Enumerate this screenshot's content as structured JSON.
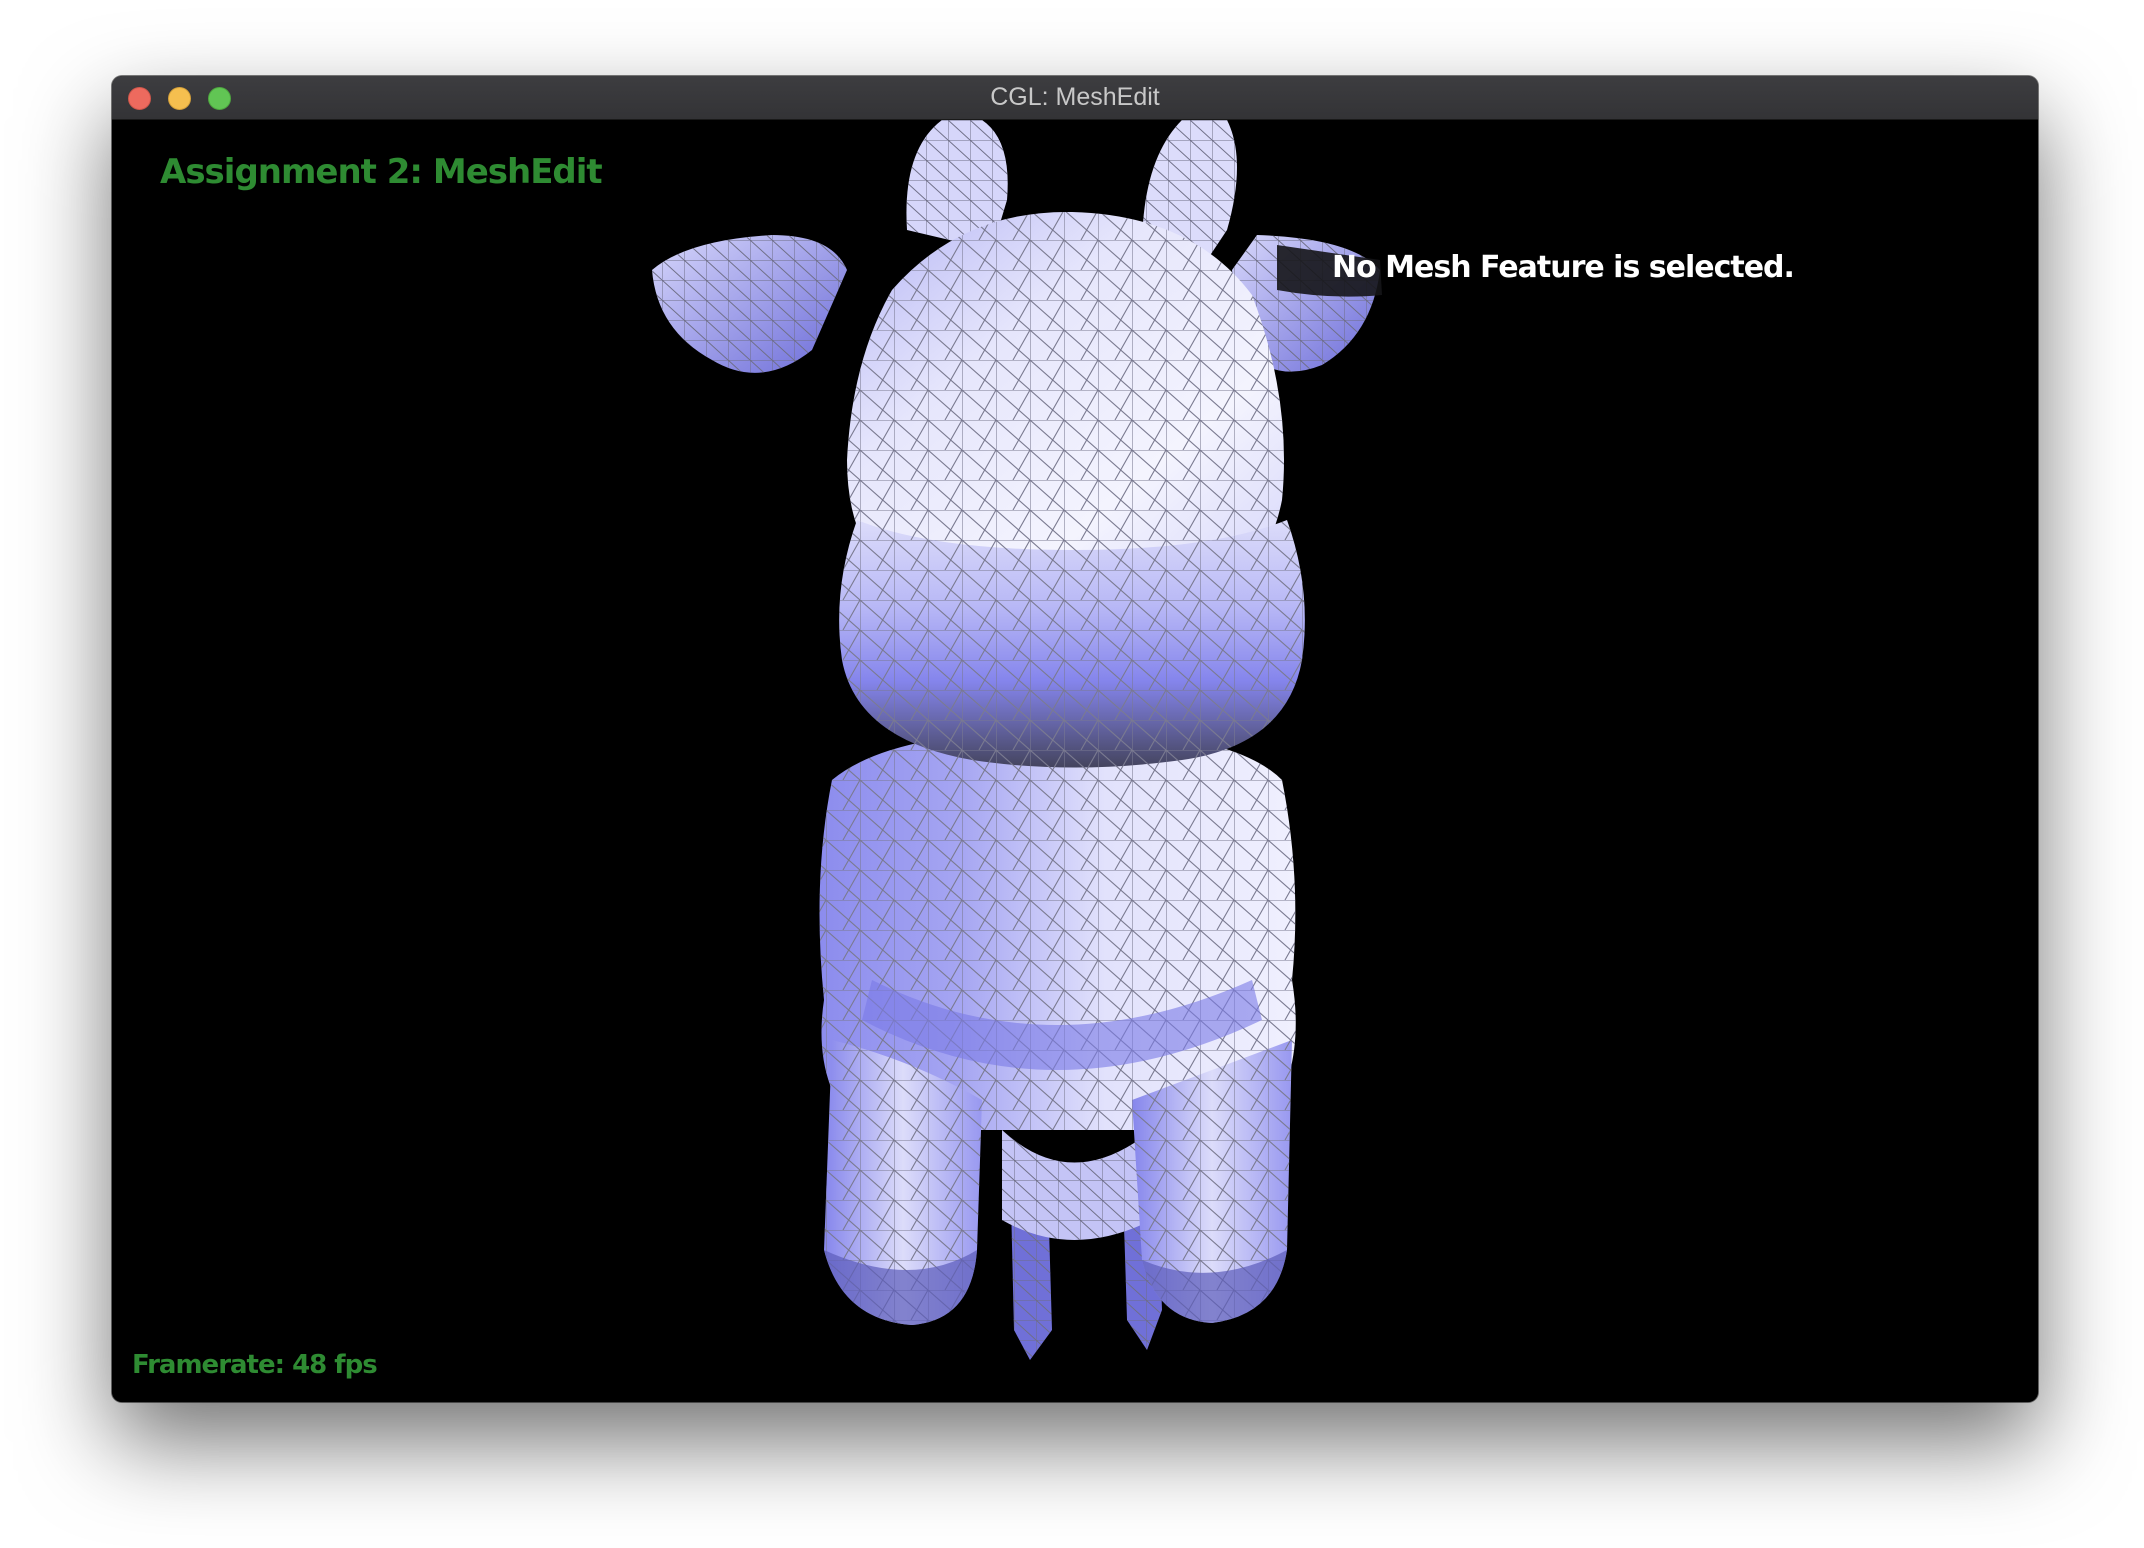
{
  "window": {
    "title": "CGL: MeshEdit"
  },
  "hud": {
    "assignment_title": "Assignment 2: MeshEdit",
    "selection_status": "No Mesh Feature is selected.",
    "framerate": "Framerate: 48 fps"
  },
  "colors": {
    "hud_green": "#2e8b32",
    "hud_white": "#ffffff",
    "mesh_light": "#ececfd",
    "mesh_mid": "#b2b2f4",
    "mesh_dark": "#7c7cec",
    "mesh_shadow": "#3c3c5c",
    "wireframe": "#77778a"
  },
  "icons": {
    "close": "close-traffic-light-icon",
    "minimize": "minimize-traffic-light-icon",
    "zoom": "zoom-traffic-light-icon"
  }
}
